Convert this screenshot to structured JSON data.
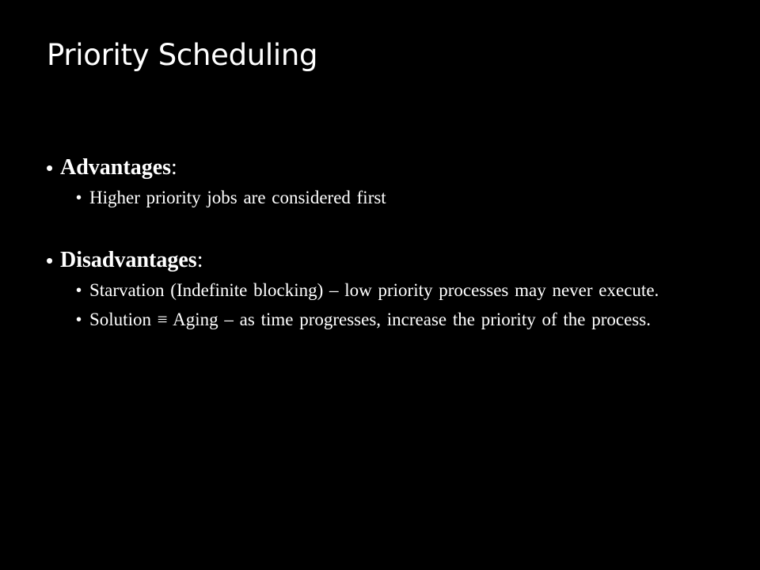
{
  "slide": {
    "title": "Priority Scheduling",
    "advantages": {
      "bullet": "•",
      "term": "Advantages",
      "suffix": ":",
      "items": [
        {
          "bullet": "•",
          "text": "Higher priority jobs are considered first"
        }
      ]
    },
    "disadvantages": {
      "bullet": "•",
      "term": "Disadvantages",
      "suffix": ":",
      "items": [
        {
          "bullet": "•",
          "text": "Starvation (Indefinite blocking) – low priority processes may never execute."
        },
        {
          "bullet": "•",
          "text": "Solution ≡ Aging – as time progresses, increase the priority of the process."
        }
      ]
    }
  },
  "colors": {
    "background": "#000000",
    "text": "#ffffff"
  }
}
